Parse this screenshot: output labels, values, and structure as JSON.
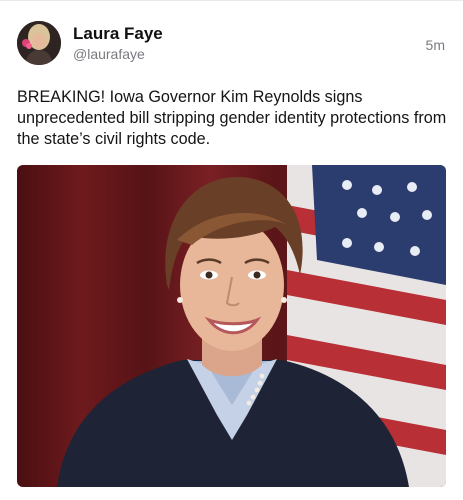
{
  "post": {
    "author_name": "Laura Faye",
    "author_handle": "@laurafaye",
    "timestamp": "5m",
    "body": "BREAKING! Iowa Governor Kim Reynolds signs unprecedented bill stripping gender identity protections from the state’s civil rights code.",
    "avatar_icon": "profile-photo",
    "image_icon": "portrait-photo"
  },
  "colors": {
    "name": "#111111",
    "secondary": "#7a7a80",
    "body": "#151515",
    "curtain": "#5e1618",
    "jacket": "#1e2436",
    "flag_blue": "#2b3d6e",
    "flag_red": "#b83035"
  }
}
